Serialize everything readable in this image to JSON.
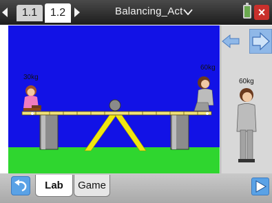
{
  "tabs": [
    {
      "label": "1.1"
    },
    {
      "label": "1.2"
    }
  ],
  "document": {
    "title": "Balancing_Act"
  },
  "scene": {
    "left_weight_label": "30kg",
    "right_weight_label": "60kg"
  },
  "side_panel": {
    "figure_label": "60kg"
  },
  "bottom_tabs": [
    {
      "label": "Lab"
    },
    {
      "label": "Game"
    }
  ],
  "colors": {
    "sky": "#1212e6",
    "grass": "#2fd62f",
    "plank": "#f1e27a",
    "support": "#f0e60f",
    "accent_button": "#5aa2e6",
    "close": "#c9302c"
  },
  "icons": {
    "prev_tab": "triangle-left-icon",
    "next_tab": "triangle-right-icon",
    "title_menu": "chevron-down-icon",
    "battery": "battery-icon",
    "close": "close-icon",
    "arrow_left": "arrow-left-icon",
    "arrow_right": "arrow-right-icon",
    "undo": "undo-icon",
    "play": "play-icon"
  }
}
